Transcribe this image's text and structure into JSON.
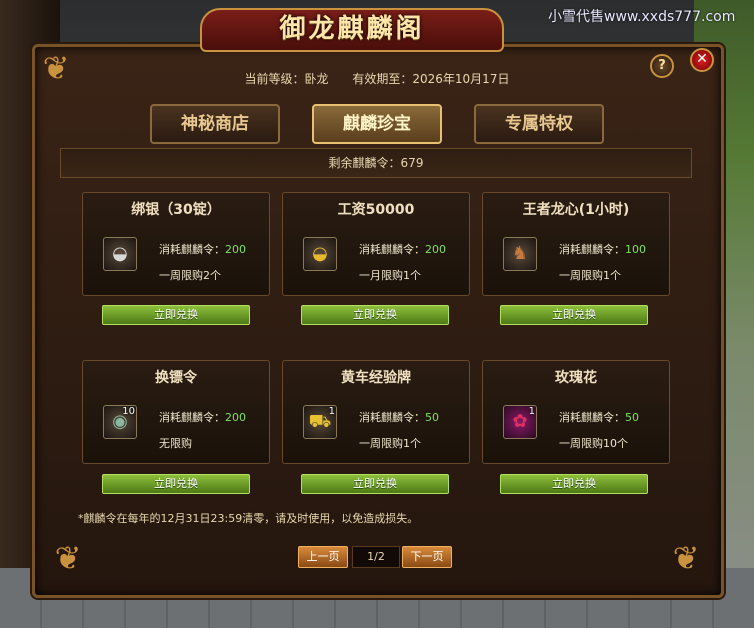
{
  "watermark": "小雪代售www.xxds777.com",
  "window": {
    "title": "御龙麒麟阁",
    "help_label": "?",
    "close_label": "✕"
  },
  "info": {
    "level_text": "当前等级：卧龙",
    "expiry_text": "有效期至：2026年10月17日"
  },
  "tabs": [
    {
      "label": "神秘商店",
      "active": false
    },
    {
      "label": "麒麟珍宝",
      "active": true
    },
    {
      "label": "专属特权",
      "active": false
    }
  ],
  "remaining_text": "剩余麒麟令：679",
  "items": [
    {
      "name": "绑银（30锭）",
      "cost_label": "消耗麒麟令：",
      "cost": "200",
      "limit": "一周限购2个",
      "icon": "silver-ingot-icon",
      "count": "",
      "button": "立即兑换"
    },
    {
      "name": "工资50000",
      "cost_label": "消耗麒麟令：",
      "cost": "200",
      "limit": "一月限购1个",
      "icon": "gold-ingot-icon",
      "count": "",
      "button": "立即兑换"
    },
    {
      "name": "王者龙心(1小时)",
      "cost_label": "消耗麒麟令：",
      "cost": "100",
      "limit": "一周限购1个",
      "icon": "dragon-heart-icon",
      "count": "",
      "button": "立即兑换"
    },
    {
      "name": "换镖令",
      "cost_label": "消耗麒麟令：",
      "cost": "200",
      "limit": "无限购",
      "icon": "escort-token-icon",
      "count": "10",
      "button": "立即兑换"
    },
    {
      "name": "黄车经验牌",
      "cost_label": "消耗麒麟令：",
      "cost": "50",
      "limit": "一周限购1个",
      "icon": "yellow-cart-card-icon",
      "count": "1",
      "button": "立即兑换"
    },
    {
      "name": "玫瑰花",
      "cost_label": "消耗麒麟令：",
      "cost": "50",
      "limit": "一周限购10个",
      "icon": "rose-icon",
      "count": "1",
      "button": "立即兑换"
    }
  ],
  "footnote": "*麒麟令在每年的12月31日23:59清零，请及时使用，以免造成损失。",
  "pager": {
    "prev": "上一页",
    "current": "1/2",
    "next": "下一页"
  },
  "colors": {
    "frame": "#24160e",
    "accent_gold": "#c8923e",
    "cost_green": "#7ee05a",
    "button_green": "#6a9e28",
    "pager_orange": "#c87028"
  }
}
